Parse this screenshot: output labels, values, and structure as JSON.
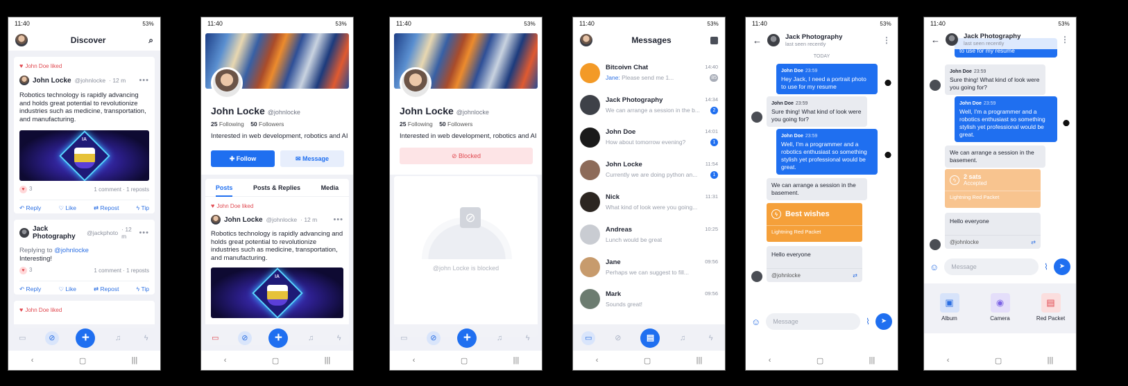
{
  "status": {
    "time": "11:40",
    "right": "53%"
  },
  "discover": {
    "title": "Discover",
    "post1": {
      "liked_by": "John Doe liked",
      "name": "John Locke",
      "handle": "@johnlocke",
      "time": "· 12 m",
      "text": "Robotics technology is rapidly advancing and holds great potential to revolutionize industries such as medicine, transportation, and manufacturing.",
      "banner": "IA",
      "likes": "3",
      "counts": "1 comment · 1 reposts"
    },
    "actions": {
      "reply": "Reply",
      "like": "Like",
      "repost": "Repost",
      "tip": "Tip"
    },
    "post2": {
      "name": "Jack Photography",
      "handle": "@jackphoto",
      "time": "· 12 m",
      "replying": "Replying to",
      "replying_handle": "@johnlocke",
      "text": "Interesting!",
      "likes": "3",
      "counts": "1 comment · 1 reposts"
    },
    "post3": {
      "liked_by": "John Doe liked"
    }
  },
  "profile": {
    "name": "John Locke",
    "handle": "@johnlocke",
    "following_count": "25",
    "following_label": "Following",
    "followers_count": "50",
    "followers_label": "Followers",
    "bio": "Interested in web development, robotics and AI",
    "follow": "Follow",
    "message": "Message",
    "tabs": [
      "Posts",
      "Posts & Replies",
      "Media"
    ],
    "post": {
      "liked_by": "John Doe liked",
      "name": "John Locke",
      "handle": "@johnlocke",
      "time": "· 12 m",
      "text": "Robotics technology is rapidly advancing and holds great potential to revolutionize industries such as medicine, transportation, and manufacturing.",
      "banner": "IA"
    }
  },
  "blocked": {
    "button": "Blocked",
    "notice": "@john Locke is blocked"
  },
  "messages": {
    "title": "Messages",
    "items": [
      {
        "name": "Bitcoivn Chat",
        "time": "14:40",
        "sender": "Jane:",
        "preview": "Please send me 1...",
        "badge": "85",
        "color": "#f39a27"
      },
      {
        "name": "Jack Photography",
        "time": "14:34",
        "preview": "We can arrange a session in the b...",
        "badge": "2",
        "color": "#3e4148"
      },
      {
        "name": "John Doe",
        "time": "14:01",
        "preview": "How about tomorrow evening?",
        "badge": "1",
        "color": "#1a1a1a"
      },
      {
        "name": "John Locke",
        "time": "11:54",
        "preview": "Currently we are doing python an...",
        "badge": "1",
        "color": "#8d6b59"
      },
      {
        "name": "Nick",
        "time": "11:31",
        "preview": "What kind of look were you going...",
        "badge": "",
        "color": "#2c2621"
      },
      {
        "name": "Andreas",
        "time": "10:25",
        "preview": "Lunch would be great",
        "badge": "",
        "color": "#c9ccd2"
      },
      {
        "name": "Jane",
        "time": "09:56",
        "preview": "Perhaps we can suggest to fill...",
        "badge": "",
        "color": "#c79b6d"
      },
      {
        "name": "Mark",
        "time": "09:56",
        "preview": "Sounds great!",
        "badge": "",
        "color": "#6c7c70"
      }
    ]
  },
  "chat": {
    "name": "Jack Photography",
    "status": "last seen recently",
    "day": "TODAY",
    "m1": {
      "who": "John Doe",
      "time": "23:59",
      "text": "Hey Jack, I need a portrait photo to use for my resume"
    },
    "m2": {
      "who": "John Doe",
      "time": "23:59",
      "text": "Sure thing! What kind of look were you going for?"
    },
    "m3": {
      "who": "John Doe",
      "time": "23:59",
      "text": "Well, I'm a programmer and a robotics enthusiast so something stylish yet professional would be great."
    },
    "m4": {
      "text": "We can arrange a session in the basement."
    },
    "packet": {
      "title": "Best wishes",
      "label": "Lightning Red Packet"
    },
    "m5": {
      "text": "Hello everyone",
      "quote": "@johnlocke"
    },
    "placeholder": "Message"
  },
  "chat2": {
    "m0": {
      "text": "to use for my resume"
    },
    "packet": {
      "amount": "2 sats",
      "state": "Accepted",
      "label": "Lightning Red Packet"
    },
    "attach": [
      "Album",
      "Camera",
      "Red Packet"
    ]
  }
}
